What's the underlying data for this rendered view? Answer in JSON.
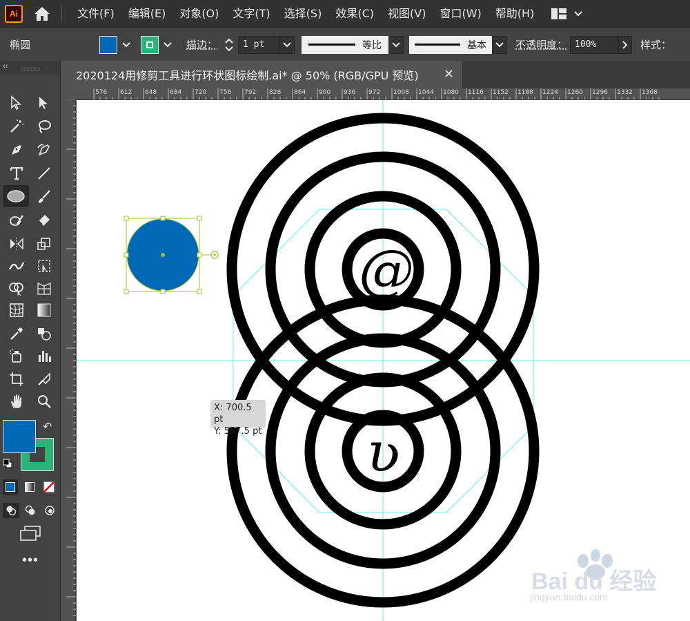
{
  "app": {
    "logo_text": "Ai"
  },
  "menu": {
    "items": [
      "文件(F)",
      "编辑(E)",
      "对象(O)",
      "文字(T)",
      "选择(S)",
      "效果(C)",
      "视图(V)",
      "窗口(W)",
      "帮助(H)"
    ]
  },
  "control_bar": {
    "object_type": "椭圆",
    "fill_color": "#0068b7",
    "stroke_color": "#2db27a",
    "stroke_label": "描边：",
    "stroke_weight": "1 pt",
    "profile_label": "等比",
    "brush_label": "基本",
    "opacity_label": "不透明度：",
    "opacity_value": "100%",
    "style_label": "样式："
  },
  "document": {
    "tab_title": "2020124用修剪工具进行环状图标绘制.ai* @ 50% (RGB/GPU 预览)"
  },
  "rulers": {
    "horizontal": [
      "576",
      "612",
      "648",
      "684",
      "720",
      "756",
      "792",
      "828",
      "864",
      "900",
      "936",
      "972",
      "1008",
      "1044",
      "1080",
      "1116",
      "1152",
      "1188",
      "1224",
      "1260",
      "1296",
      "1332",
      "1368"
    ]
  },
  "tooltip": {
    "x": "X: 700.5 pt",
    "y": "Y: 557.5 pt"
  },
  "artwork": {
    "top_glyph": "@",
    "bottom_glyph": "ʋ"
  },
  "watermark": {
    "brand": "Bai du 经验",
    "url": "jingyan.baidu.com"
  },
  "colors": {
    "accent_blue": "#0068b7",
    "stroke_green": "#2db27a",
    "guide_cyan": "#5ff0f0",
    "selection_green": "#9bc426"
  }
}
